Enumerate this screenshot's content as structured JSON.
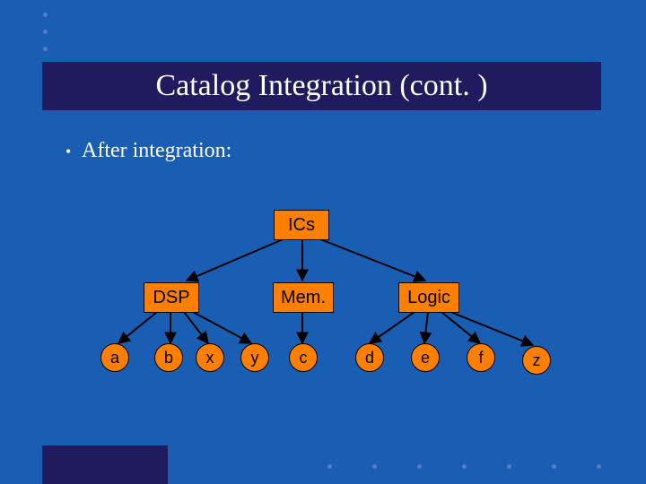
{
  "title": "Catalog Integration (cont. )",
  "bullet": "After integration:",
  "nodes": {
    "root": "ICs",
    "dsp": "DSP",
    "mem": "Mem.",
    "logic": "Logic",
    "a": "a",
    "b": "b",
    "x": "x",
    "y": "y",
    "c": "c",
    "d": "d",
    "e": "e",
    "f": "f",
    "z": "z"
  }
}
